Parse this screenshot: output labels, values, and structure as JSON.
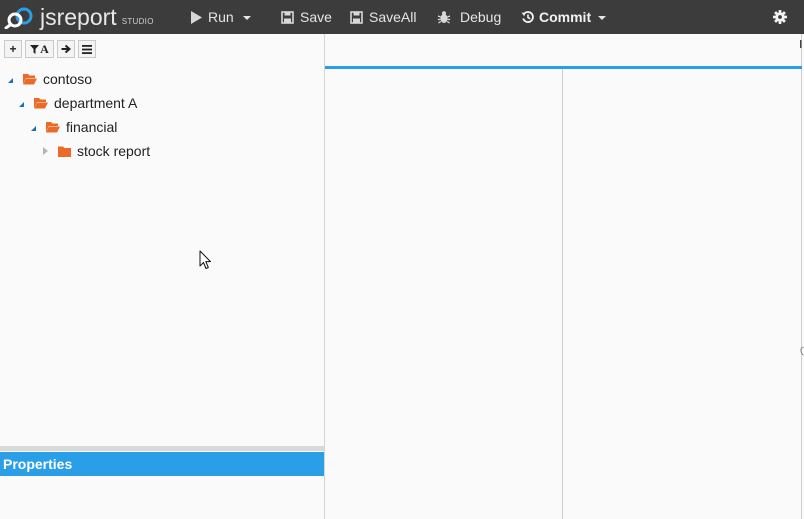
{
  "app": {
    "logo_text": "jsreport",
    "logo_sub": "STUDIO"
  },
  "toolbar": {
    "run_label": "Run",
    "save_label": "Save",
    "saveall_label": "SaveAll",
    "debug_label": "Debug",
    "commit_label": "Commit",
    "icons": {
      "run": "play-icon",
      "save": "floppy-disk-icon",
      "saveall": "floppy-disk-icon",
      "debug": "bug-icon",
      "commit": "history-icon",
      "settings": "gear-icon"
    }
  },
  "tree_toolbar": {
    "add_glyph": "+",
    "filter_glyph": "A",
    "icons": [
      "plus-icon",
      "filter-icon",
      "arrow-right-icon",
      "hamburger-menu-icon"
    ]
  },
  "tree": {
    "nodes": [
      {
        "label": "contoso",
        "expanded": true,
        "icon": "folder-open-icon"
      },
      {
        "label": "department A",
        "expanded": true,
        "icon": "folder-open-icon"
      },
      {
        "label": "financial",
        "expanded": true,
        "icon": "folder-open-icon"
      },
      {
        "label": "stock report",
        "expanded": false,
        "icon": "folder-icon"
      }
    ]
  },
  "properties": {
    "title": "Properties"
  },
  "colors": {
    "toolbar_bg": "#3c3c3c",
    "accent": "#2a9fe8",
    "folder": "#ec6a28",
    "tree_toggle": "#1e6fb8"
  }
}
